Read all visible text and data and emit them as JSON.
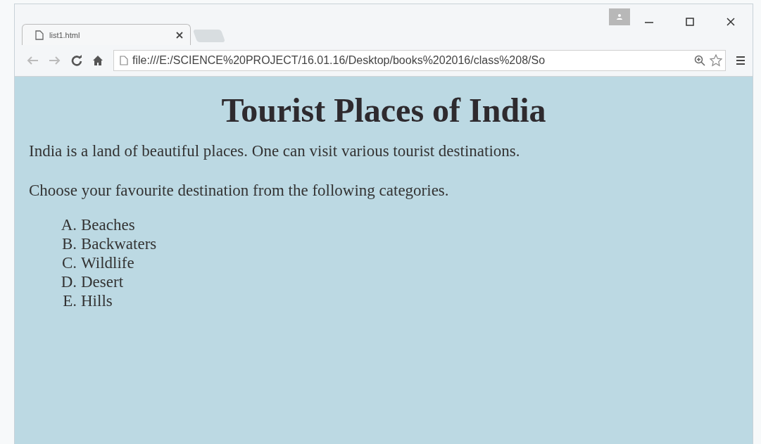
{
  "window": {
    "tab": {
      "title": "list1.html",
      "selected": true
    },
    "address": "file:///E:/SCIENCE%20PROJECT/16.01.16/Desktop/books%202016/class%208/So"
  },
  "page": {
    "heading": "Tourist Places of India",
    "paragraphs": [
      "India is a land of beautiful places. One can visit various tourist destinations.",
      "Choose your favourite destination from the following categories."
    ],
    "list": [
      {
        "marker": "A.",
        "text": "Beaches"
      },
      {
        "marker": "B.",
        "text": "Backwaters"
      },
      {
        "marker": "C.",
        "text": "Wildlife"
      },
      {
        "marker": "D.",
        "text": "Desert"
      },
      {
        "marker": "E.",
        "text": "Hills"
      }
    ]
  }
}
